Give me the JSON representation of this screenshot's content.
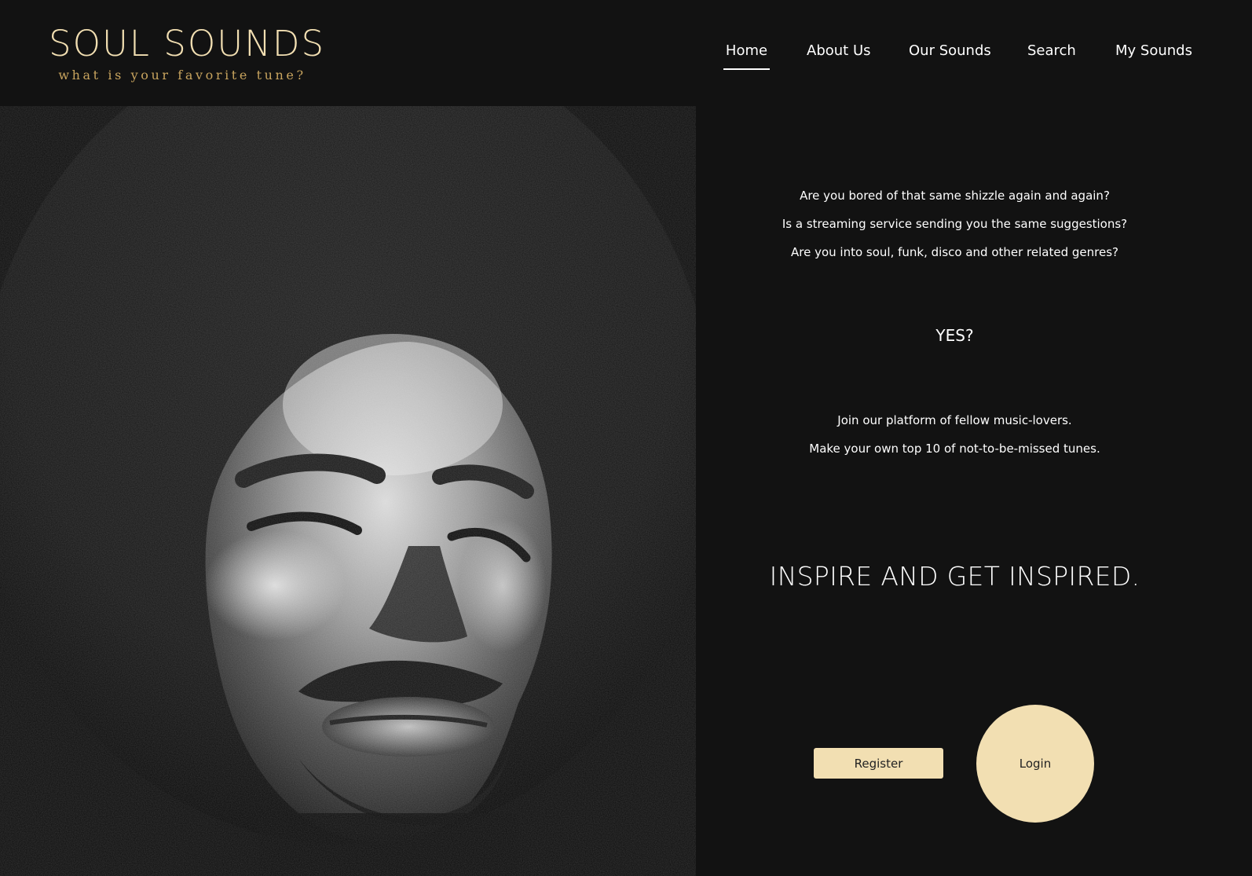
{
  "brand": {
    "title": "SOUL SOUNDS",
    "tagline": "what is your favorite tune?"
  },
  "nav": {
    "items": [
      {
        "label": "Home",
        "active": true
      },
      {
        "label": "About Us",
        "active": false
      },
      {
        "label": "Our Sounds",
        "active": false
      },
      {
        "label": "Search",
        "active": false
      },
      {
        "label": "My Sounds",
        "active": false
      }
    ]
  },
  "hero": {
    "image": "black-and-white-portrait-photo"
  },
  "intro": {
    "questions": [
      "Are you bored of that same shizzle again and again?",
      "Is a streaming service sending you the same suggestions?",
      "Are you into soul, funk, disco and other related genres?"
    ],
    "yes": "YES?",
    "join": [
      "Join our platform of fellow music-lovers.",
      "Make your own top 10 of not-to-be-missed tunes."
    ],
    "slogan": "INSPIRE AND GET INSPIRED."
  },
  "actions": {
    "register_label": "Register",
    "login_label": "Login"
  },
  "colors": {
    "background": "#121212",
    "accent": "#f2dfb2",
    "tagline": "#c8a45e",
    "text": "#ffffff"
  }
}
